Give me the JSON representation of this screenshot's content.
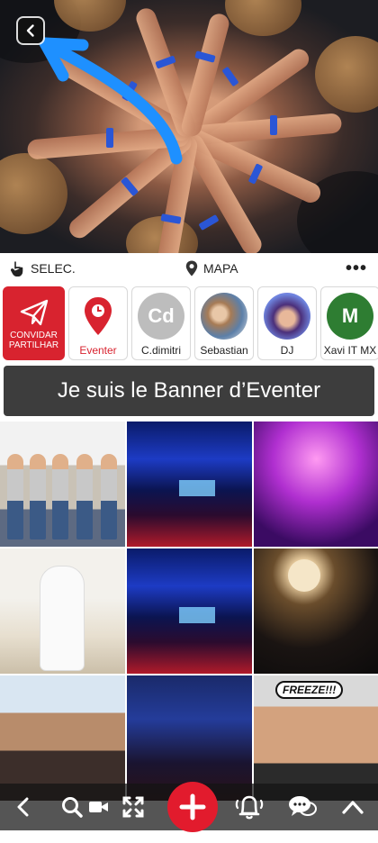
{
  "toolbar": {
    "select_label": "SELEC.",
    "map_label": "MAPA",
    "more_label": "•••"
  },
  "stories": [
    {
      "label_line1": "CONVIDAR",
      "label_line2": "PARTILHAR",
      "icon": "paper-plane-icon"
    },
    {
      "label": "Eventer",
      "icon": "location-pin-icon",
      "color": "#d8232f"
    },
    {
      "label": "C.dimitri",
      "initials": "Cd",
      "color": "#bdbdbd"
    },
    {
      "label": "Sebastian",
      "color": "#b08968"
    },
    {
      "label": "DJ",
      "color": "#5a6fd6"
    },
    {
      "label": "Xavi IT MX",
      "initials": "M",
      "color": "#2e7d32"
    }
  ],
  "banner": {
    "text": "Je suis le Banner d’Eventer"
  },
  "grid": {
    "freeze_text": "FREEZE!!!"
  },
  "colors": {
    "accent": "#d8232f",
    "arrow": "#1e90ff"
  }
}
